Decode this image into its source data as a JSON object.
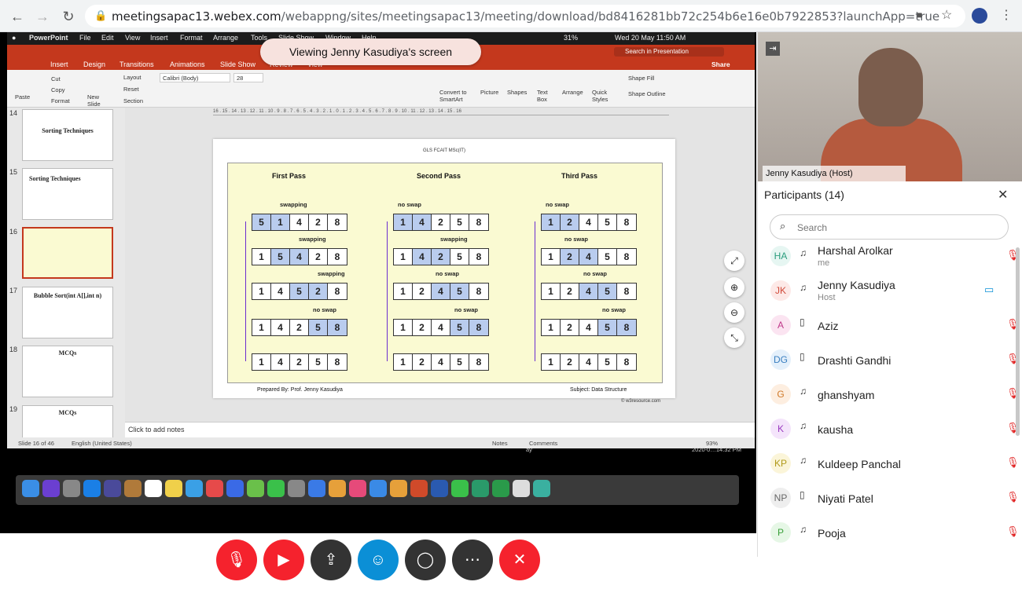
{
  "browser": {
    "url_host": "meetingsapac13.webex.com",
    "url_path": "/webappng/sites/meetingsapac13/meeting/download/bd8416281bb72c254b6e16e0b7922853?launchApp=true"
  },
  "mac_menu": {
    "apple": "",
    "app": "PowerPoint",
    "items": [
      "File",
      "Edit",
      "View",
      "Insert",
      "Format",
      "Arrange",
      "Tools",
      "Slide Show",
      "Window",
      "Help"
    ],
    "battery": "31%",
    "datetime": "Wed 20 May  11:50 AM"
  },
  "ppt": {
    "search_placeholder": "Search in Presentation",
    "share": "Share",
    "tabs": [
      "Insert",
      "Design",
      "Transitions",
      "Animations",
      "Slide Show",
      "Review",
      "View"
    ],
    "tools": {
      "paste": "Paste",
      "cut": "Cut",
      "copy": "Copy",
      "format": "Format",
      "new_slide": "New Slide",
      "layout": "Layout",
      "reset": "Reset",
      "section": "Section",
      "font": "Calibri (Body)",
      "size": "28",
      "convert": "Convert to SmartArt",
      "picture": "Picture",
      "shapes": "Shapes",
      "text_box": "Text Box",
      "arrange": "Arrange",
      "quick_styles": "Quick Styles",
      "shape_fill": "Shape Fill",
      "shape_outline": "Shape Outline"
    },
    "thumbs": [
      {
        "num": "14",
        "title": "Sorting Techniques"
      },
      {
        "num": "15",
        "title": "Sorting Techniques"
      },
      {
        "num": "16",
        "title": ""
      },
      {
        "num": "17",
        "title": "Bubble Sort(int A[],int n)"
      },
      {
        "num": "18",
        "title": "MCQs"
      },
      {
        "num": "19",
        "title": "MCQs"
      }
    ],
    "ruler": "16 . 15 . 14 . 13 . 12 . 11 . 10 . 9 . 8 . 7 . 6 . 5 . 4 . 3 . 2 . 1 . 0 . 1 . 2 . 3 . 4 . 5 . 6 . 7 . 8 . 9 . 10 . 11 . 12 . 13 . 14 . 15 . 16",
    "notes": "Click to add notes",
    "status": {
      "slide": "Slide 16 of 46",
      "lang": "English (United States)",
      "notes": "Notes",
      "comments": "Comments",
      "zoom": "93%",
      "clock": "2020-0…14.32 PM",
      "extra": "ay"
    }
  },
  "banner": "Viewing Jenny Kasudiya's screen",
  "slide": {
    "header": "GLS FCAIT MSc(IT)",
    "passes": [
      "First  Pass",
      "Second  Pass",
      "Third  Pass"
    ],
    "rows": [
      [
        [
          "5",
          "1",
          "4",
          "2",
          "8"
        ],
        [
          "1",
          "4",
          "2",
          "5",
          "8"
        ],
        [
          "1",
          "2",
          "4",
          "5",
          "8"
        ]
      ],
      [
        [
          "1",
          "5",
          "4",
          "2",
          "8"
        ],
        [
          "1",
          "4",
          "2",
          "5",
          "8"
        ],
        [
          "1",
          "2",
          "4",
          "5",
          "8"
        ]
      ],
      [
        [
          "1",
          "4",
          "5",
          "2",
          "8"
        ],
        [
          "1",
          "2",
          "4",
          "5",
          "8"
        ],
        [
          "1",
          "2",
          "4",
          "5",
          "8"
        ]
      ],
      [
        [
          "1",
          "4",
          "2",
          "5",
          "8"
        ],
        [
          "1",
          "2",
          "4",
          "5",
          "8"
        ],
        [
          "1",
          "2",
          "4",
          "5",
          "8"
        ]
      ],
      [
        [
          "1",
          "4",
          "2",
          "5",
          "8"
        ],
        [
          "1",
          "2",
          "4",
          "5",
          "8"
        ],
        [
          "1",
          "2",
          "4",
          "5",
          "8"
        ]
      ]
    ],
    "notes": {
      "swapping": "swapping",
      "no_swap": "no swap"
    },
    "credit": "© w3resource.com",
    "footer_left": "Prepared By: Prof. Jenny Kasudiya",
    "footer_right": "Subject: Data Structure"
  },
  "side": {
    "presenter_label": "Jenny Kasudiya (Host)",
    "participants_title": "Participants (14)",
    "search_placeholder": "Search",
    "participants": [
      {
        "initials": "HA",
        "name": "Harshal Arolkar",
        "role": "me",
        "avbg": "#e6f6f2",
        "avfg": "#2a9d7d"
      },
      {
        "initials": "JK",
        "name": "Jenny Kasudiya",
        "role": "Host",
        "avbg": "#fde9e7",
        "avfg": "#d04a3a"
      },
      {
        "initials": "A",
        "name": "Aziz",
        "role": "",
        "avbg": "#fbe4f1",
        "avfg": "#c0398a"
      },
      {
        "initials": "DG",
        "name": "Drashti Gandhi",
        "role": "",
        "avbg": "#e4f0fb",
        "avfg": "#3a7fc0"
      },
      {
        "initials": "G",
        "name": "ghanshyam",
        "role": "",
        "avbg": "#fdeee0",
        "avfg": "#d07a2a"
      },
      {
        "initials": "K",
        "name": "kausha",
        "role": "",
        "avbg": "#f4e4fb",
        "avfg": "#9a3ac0"
      },
      {
        "initials": "KP",
        "name": "Kuldeep Panchal",
        "role": "",
        "avbg": "#fbf5d9",
        "avfg": "#b09a1a"
      },
      {
        "initials": "NP",
        "name": "Niyati Patel",
        "role": "",
        "avbg": "#eeeeee",
        "avfg": "#666666"
      },
      {
        "initials": "P",
        "name": "Pooja",
        "role": "",
        "avbg": "#e6f7e6",
        "avfg": "#3aa03a"
      }
    ]
  },
  "colors": {
    "ppt_red": "#c4381d",
    "mute_red": "#f5222d",
    "share_dark": "#333333",
    "participants_blue": "#0b8fd6"
  }
}
